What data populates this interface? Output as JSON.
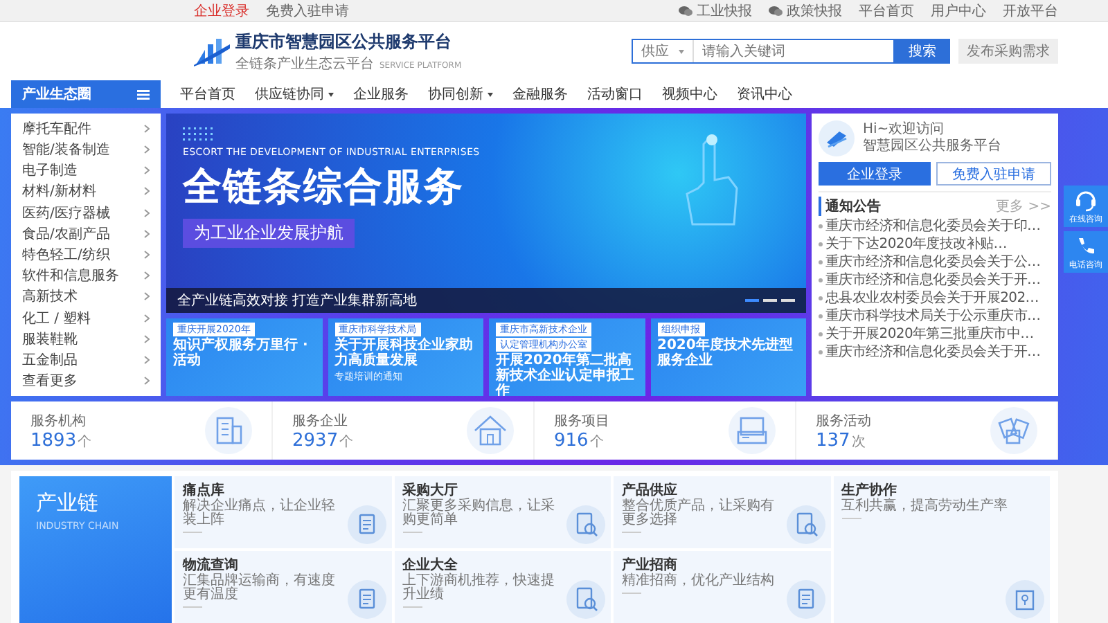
{
  "top_bar": {
    "left_links": [
      {
        "label": "企业登录",
        "kind": "highlight"
      },
      {
        "label": "免费入驻申请",
        "kind": "plain"
      }
    ],
    "right_links": [
      {
        "label": "工业快报",
        "kind": "feed"
      },
      {
        "label": "政策快报",
        "kind": "feed"
      },
      {
        "label": "平台首页",
        "kind": "plain"
      },
      {
        "label": "用户中心",
        "kind": "plain"
      },
      {
        "label": "开放平台",
        "kind": "plain"
      }
    ]
  },
  "header": {
    "title": "重庆市智慧园区公共服务平台",
    "subtitle": "全链条产业生态云平台",
    "subtitle_en": "SERVICE PLATFORM",
    "search": {
      "scope": "供应",
      "placeholder": "请输入关键词",
      "button": "搜索"
    },
    "publish_button": "发布采购需求"
  },
  "nav": {
    "category_title": "产业生态圈",
    "items": [
      {
        "label": "平台首页",
        "has_menu": false
      },
      {
        "label": "供应链协同",
        "has_menu": true
      },
      {
        "label": "企业服务",
        "has_menu": false
      },
      {
        "label": "协同创新",
        "has_menu": true
      },
      {
        "label": "金融服务",
        "has_menu": false
      },
      {
        "label": "活动窗口",
        "has_menu": false
      },
      {
        "label": "视频中心",
        "has_menu": false
      },
      {
        "label": "资讯中心",
        "has_menu": false
      }
    ]
  },
  "categories": [
    "摩托车配件",
    "智能/装备制造",
    "电子制造",
    "材料/新材料",
    "医药/医疗器械",
    "食品/农副产品",
    "特色轻工/纺织",
    "软件和信息服务",
    "高新技术",
    "化工 / 塑料",
    "服装鞋靴",
    "五金制品",
    "查看更多"
  ],
  "banner": {
    "tagline": "ESCORT THE DEVELOPMENT OF INDUSTRIAL ENTERPRISES",
    "headline": "全链条综合服务",
    "slogan": "为工业企业发展护航",
    "caption": "全产业链高效对接 打造产业集群新高地",
    "dots": [
      {
        "selected": true
      },
      {
        "selected": false
      },
      {
        "selected": false
      }
    ]
  },
  "promo_cards": [
    {
      "tags": [
        "重庆开展2020年"
      ],
      "title": "知识产权服务万里行 · 活动"
    },
    {
      "tags": [
        "重庆市科学技术局"
      ],
      "title": "关于开展科技企业家助力高质量发展",
      "note": "专题培训的通知"
    },
    {
      "tags": [
        "重庆市高新技术企业",
        "认定管理机构办公室"
      ],
      "title": "开展2020年第二批高新技术企业认定申报工作"
    },
    {
      "tags": [
        "组织申报"
      ],
      "title": "2020年度技术先进型服务企业"
    }
  ],
  "welcome": {
    "greeting": "Hi~欢迎访问",
    "platform": "智慧园区公共服务平台",
    "login_button": "企业登录",
    "apply_button": "免费入驻申请"
  },
  "notices": {
    "title": "通知公告",
    "more": "更多 >>",
    "items": [
      "重庆市经济和信息化委员会关于印…",
      "关于下达2020年度技改补贴…",
      "重庆市经济和信息化委员会关于公…",
      "重庆市经济和信息化委员会关于开…",
      "忠县农业农村委员会关于开展202…",
      "重庆市科学技术局关于公示重庆市…",
      "关于开展2020年第三批重庆市中…",
      "重庆市经济和信息化委员会关于开…"
    ]
  },
  "stats": [
    {
      "label": "服务机构",
      "value": "1893",
      "unit": "个",
      "kind": "building"
    },
    {
      "label": "服务企业",
      "value": "2937",
      "unit": "个",
      "kind": "house"
    },
    {
      "label": "服务项目",
      "value": "916",
      "unit": "个",
      "kind": "screen"
    },
    {
      "label": "服务活动",
      "value": "137",
      "unit": "次",
      "kind": "cards"
    }
  ],
  "industry_chain": {
    "title": "产业链",
    "subtitle": "INDUSTRY CHAIN",
    "tiles": [
      {
        "title": "痛点库",
        "desc": "解决企业痛点，让企业轻装上阵",
        "kind": "list"
      },
      {
        "title": "采购大厅",
        "desc": "汇聚更多采购信息，让采购更简单",
        "kind": "search"
      },
      {
        "title": "产品供应",
        "desc": "整合优质产品，让采购有更多选择",
        "kind": "search"
      },
      {
        "title": "生产协作",
        "desc": "互利共赢，提高劳动生产率",
        "kind": "tall"
      },
      {
        "title": "物流查询",
        "desc": "汇集品牌运输商，有速度更有温度",
        "kind": "list"
      },
      {
        "title": "企业大全",
        "desc": "上下游商机推荐，快速提升业绩",
        "kind": "search"
      },
      {
        "title": "产业招商",
        "desc": "精准招商，优化产业结构",
        "kind": "list"
      }
    ]
  },
  "float_buttons": [
    {
      "label": "在线咨询",
      "kind": "chat"
    },
    {
      "label": "电话咨询",
      "kind": "phone"
    }
  ]
}
